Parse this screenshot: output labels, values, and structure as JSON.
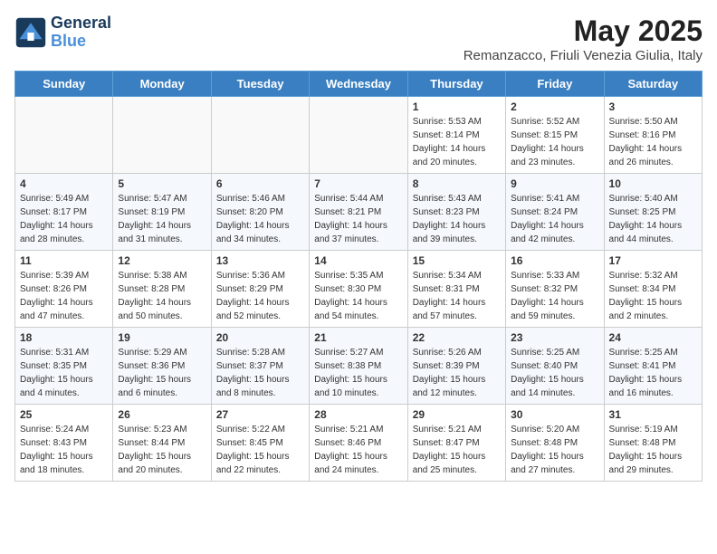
{
  "header": {
    "logo_line1": "General",
    "logo_line2": "Blue",
    "month": "May 2025",
    "location": "Remanzacco, Friuli Venezia Giulia, Italy"
  },
  "weekdays": [
    "Sunday",
    "Monday",
    "Tuesday",
    "Wednesday",
    "Thursday",
    "Friday",
    "Saturday"
  ],
  "weeks": [
    [
      {
        "day": "",
        "sunrise": "",
        "sunset": "",
        "daylight": ""
      },
      {
        "day": "",
        "sunrise": "",
        "sunset": "",
        "daylight": ""
      },
      {
        "day": "",
        "sunrise": "",
        "sunset": "",
        "daylight": ""
      },
      {
        "day": "",
        "sunrise": "",
        "sunset": "",
        "daylight": ""
      },
      {
        "day": "1",
        "sunrise": "5:53 AM",
        "sunset": "8:14 PM",
        "daylight": "14 hours and 20 minutes."
      },
      {
        "day": "2",
        "sunrise": "5:52 AM",
        "sunset": "8:15 PM",
        "daylight": "14 hours and 23 minutes."
      },
      {
        "day": "3",
        "sunrise": "5:50 AM",
        "sunset": "8:16 PM",
        "daylight": "14 hours and 26 minutes."
      }
    ],
    [
      {
        "day": "4",
        "sunrise": "5:49 AM",
        "sunset": "8:17 PM",
        "daylight": "14 hours and 28 minutes."
      },
      {
        "day": "5",
        "sunrise": "5:47 AM",
        "sunset": "8:19 PM",
        "daylight": "14 hours and 31 minutes."
      },
      {
        "day": "6",
        "sunrise": "5:46 AM",
        "sunset": "8:20 PM",
        "daylight": "14 hours and 34 minutes."
      },
      {
        "day": "7",
        "sunrise": "5:44 AM",
        "sunset": "8:21 PM",
        "daylight": "14 hours and 37 minutes."
      },
      {
        "day": "8",
        "sunrise": "5:43 AM",
        "sunset": "8:23 PM",
        "daylight": "14 hours and 39 minutes."
      },
      {
        "day": "9",
        "sunrise": "5:41 AM",
        "sunset": "8:24 PM",
        "daylight": "14 hours and 42 minutes."
      },
      {
        "day": "10",
        "sunrise": "5:40 AM",
        "sunset": "8:25 PM",
        "daylight": "14 hours and 44 minutes."
      }
    ],
    [
      {
        "day": "11",
        "sunrise": "5:39 AM",
        "sunset": "8:26 PM",
        "daylight": "14 hours and 47 minutes."
      },
      {
        "day": "12",
        "sunrise": "5:38 AM",
        "sunset": "8:28 PM",
        "daylight": "14 hours and 50 minutes."
      },
      {
        "day": "13",
        "sunrise": "5:36 AM",
        "sunset": "8:29 PM",
        "daylight": "14 hours and 52 minutes."
      },
      {
        "day": "14",
        "sunrise": "5:35 AM",
        "sunset": "8:30 PM",
        "daylight": "14 hours and 54 minutes."
      },
      {
        "day": "15",
        "sunrise": "5:34 AM",
        "sunset": "8:31 PM",
        "daylight": "14 hours and 57 minutes."
      },
      {
        "day": "16",
        "sunrise": "5:33 AM",
        "sunset": "8:32 PM",
        "daylight": "14 hours and 59 minutes."
      },
      {
        "day": "17",
        "sunrise": "5:32 AM",
        "sunset": "8:34 PM",
        "daylight": "15 hours and 2 minutes."
      }
    ],
    [
      {
        "day": "18",
        "sunrise": "5:31 AM",
        "sunset": "8:35 PM",
        "daylight": "15 hours and 4 minutes."
      },
      {
        "day": "19",
        "sunrise": "5:29 AM",
        "sunset": "8:36 PM",
        "daylight": "15 hours and 6 minutes."
      },
      {
        "day": "20",
        "sunrise": "5:28 AM",
        "sunset": "8:37 PM",
        "daylight": "15 hours and 8 minutes."
      },
      {
        "day": "21",
        "sunrise": "5:27 AM",
        "sunset": "8:38 PM",
        "daylight": "15 hours and 10 minutes."
      },
      {
        "day": "22",
        "sunrise": "5:26 AM",
        "sunset": "8:39 PM",
        "daylight": "15 hours and 12 minutes."
      },
      {
        "day": "23",
        "sunrise": "5:25 AM",
        "sunset": "8:40 PM",
        "daylight": "15 hours and 14 minutes."
      },
      {
        "day": "24",
        "sunrise": "5:25 AM",
        "sunset": "8:41 PM",
        "daylight": "15 hours and 16 minutes."
      }
    ],
    [
      {
        "day": "25",
        "sunrise": "5:24 AM",
        "sunset": "8:43 PM",
        "daylight": "15 hours and 18 minutes."
      },
      {
        "day": "26",
        "sunrise": "5:23 AM",
        "sunset": "8:44 PM",
        "daylight": "15 hours and 20 minutes."
      },
      {
        "day": "27",
        "sunrise": "5:22 AM",
        "sunset": "8:45 PM",
        "daylight": "15 hours and 22 minutes."
      },
      {
        "day": "28",
        "sunrise": "5:21 AM",
        "sunset": "8:46 PM",
        "daylight": "15 hours and 24 minutes."
      },
      {
        "day": "29",
        "sunrise": "5:21 AM",
        "sunset": "8:47 PM",
        "daylight": "15 hours and 25 minutes."
      },
      {
        "day": "30",
        "sunrise": "5:20 AM",
        "sunset": "8:48 PM",
        "daylight": "15 hours and 27 minutes."
      },
      {
        "day": "31",
        "sunrise": "5:19 AM",
        "sunset": "8:48 PM",
        "daylight": "15 hours and 29 minutes."
      }
    ]
  ]
}
